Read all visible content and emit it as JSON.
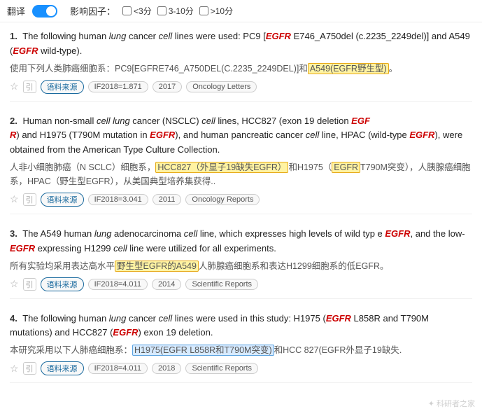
{
  "topbar": {
    "translate_label": "翻译",
    "impact_label": "影响因子：",
    "filters": [
      {
        "id": "f1",
        "label": "<3分"
      },
      {
        "id": "f2",
        "label": "3-10分"
      },
      {
        "id": "f3",
        "label": ">10分"
      }
    ]
  },
  "results": [
    {
      "num": "1.",
      "en": "The following human lung cancer cell lines were used: PC9 [EGFR E746_A750del (c.2235_2249del)] and A549 (EGFR wild-type).",
      "zh": "使用下列人类肺癌细胞系：PC9[EGFRE746_A750DEL(C.2235_2249DEL)]和A549(EGFR野生型)。",
      "zh_highlight": "A549(EGFR野生型)",
      "meta_if": "IF2018=1.871",
      "meta_year": "2017",
      "meta_journal": "Oncology Letters"
    },
    {
      "num": "2.",
      "en": "Human non-small cell lung cancer (NSCLC) cell lines, HCC827 (exon 19 deletion EGFR) and H1975 (T790M mutation in EGFR), and human pancreatic cancer cell line, HPAC (wild-type EGFR), were obtained from the American Type Culture Collection.",
      "zh": "人非小细胞肺癌（N SCLC）细胞系，HCC827（外显子19缺失EGFR）和H1975（EGFR T790M突变），人胰腺癌细胞系，HPAC（野生型EGFR），从美国典型培养集获得..",
      "zh_highlight1": "HCC827（外显子19缺失EGFR）",
      "zh_highlight2": "EGFR",
      "meta_if": "IF2018=3.041",
      "meta_year": "2011",
      "meta_journal": "Oncology Reports"
    },
    {
      "num": "3.",
      "en": "The A549 human lung adenocarcinoma cell line, which expresses high levels of wild type EGFR, and the low-EGFR expressing H1299 cell line were utilized for all experiments.",
      "zh": "所有实验均采用表达高水平野生型EGFR的A549人肺腺癌细胞系和表达H1299细胞系的低EGFR。",
      "zh_highlight": "野生型EGFR的A549",
      "meta_if": "IF2018=4.011",
      "meta_year": "2014",
      "meta_journal": "Scientific Reports"
    },
    {
      "num": "4.",
      "en": "The following human lung cancer cell lines were used in this study: H1975 (EGFR L858R and T790M mutations) and HCC827 (EGFR exon 19 deletion.",
      "zh": "本研究采用以下人肺癌细胞系：H1975(EGFR L858R和T790M突变)和HCC 827(EGFR外显子19缺失.",
      "zh_highlight": "H1975(EGFR L858R和T790M突变)",
      "meta_if": "IF2018=4.011",
      "meta_year": "2018",
      "meta_journal": "Scientific Reports"
    }
  ],
  "watermark": "科研者之家"
}
